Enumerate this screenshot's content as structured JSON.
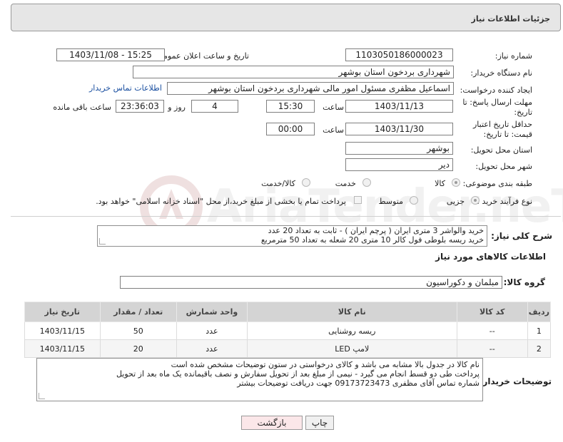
{
  "header": {
    "title": "جزئیات اطلاعات نیاز"
  },
  "form": {
    "need_number_label": "شماره نیاز:",
    "need_number": "1103050186000023",
    "announce_label": "تاریخ و ساعت اعلان عمومی:",
    "announce_value": "1403/11/08 - 15:25",
    "buyer_org_label": "نام دستگاه خریدار:",
    "buyer_org": "شهرداری بردخون استان بوشهر",
    "creator_label": "ایجاد کننده درخواست:",
    "creator": "اسماعیل مظفری مسئول امور مالی شهرداری بردخون استان بوشهر",
    "contact_link": "اطلاعات تماس خریدار",
    "deadline_label": "مهلت ارسال پاسخ: تا تاریخ:",
    "deadline_date": "1403/11/13",
    "time_label": "ساعت",
    "deadline_time": "15:30",
    "days_value": "4",
    "days_and_label": "روز و",
    "remaining_time": "23:36:03",
    "remaining_label": "ساعت باقی مانده",
    "validity_label": "حداقل تاریخ اعتبار قیمت: تا تاریخ:",
    "validity_date": "1403/11/30",
    "validity_time_label": "ساعت",
    "validity_time": "00:00",
    "province_label": "استان محل تحویل:",
    "province": "بوشهر",
    "city_label": "شهر محل تحویل:",
    "city": "دیر",
    "category_label": "طبقه بندی موضوعی:",
    "category_options": [
      "کالا",
      "خدمت",
      "کالا/خدمت"
    ],
    "process_label": "نوع فرآیند خرید :",
    "process_options": [
      "جزیی",
      "متوسط"
    ],
    "payment_note": "پرداخت تمام یا بخشی از مبلغ خرید،از محل \"اسناد خزانه اسلامی\" خواهد بود."
  },
  "description": {
    "label": "شرح کلی نیاز:",
    "lines": [
      "خرید والواشر 3 متری ایران ( پرچم ایران ) - ثابت به تعداد 20 عدد",
      "خرید ریسه بلوطی فول کالر 10 متری 20 شعله به تعداد 50 مترمربع"
    ]
  },
  "goods": {
    "section_title": "اطلاعات کالاهای مورد نیاز",
    "group_label": "گروه کالا:",
    "group_value": "مبلمان و دکوراسیون",
    "columns": [
      "ردیف",
      "کد کالا",
      "نام کالا",
      "واحد شمارش",
      "تعداد / مقدار",
      "تاریخ نیاز"
    ],
    "rows": [
      [
        "1",
        "--",
        "ریسه روشنایی",
        "عدد",
        "50",
        "1403/11/15"
      ],
      [
        "2",
        "--",
        "لامپ LED",
        "عدد",
        "20",
        "1403/11/15"
      ]
    ]
  },
  "buyer_notes": {
    "label": "توضیحات خریدار:",
    "lines": [
      "نام کالا در جدول بالا مشابه می باشد و کالای درخواستی در ستون توضیحات مشخص شده است",
      "پرداخت طی دو قسط انجام می گیرد - نیمی از مبلغ بعد از تحویل سفارش و نصف باقیمانده یک ماه بعد از تحویل",
      "شماره تماس آقای مظفری  09173723473 جهت دریافت توضیحات بیشتر"
    ]
  },
  "actions": {
    "print": "چاپ",
    "back": "بازگشت"
  },
  "watermark": {
    "text": "AriaTender.neT"
  },
  "colors": {
    "link": "#1a4fa0",
    "header_bg": "#e6e6e6",
    "back_button_bg": "#fbe7e9"
  }
}
